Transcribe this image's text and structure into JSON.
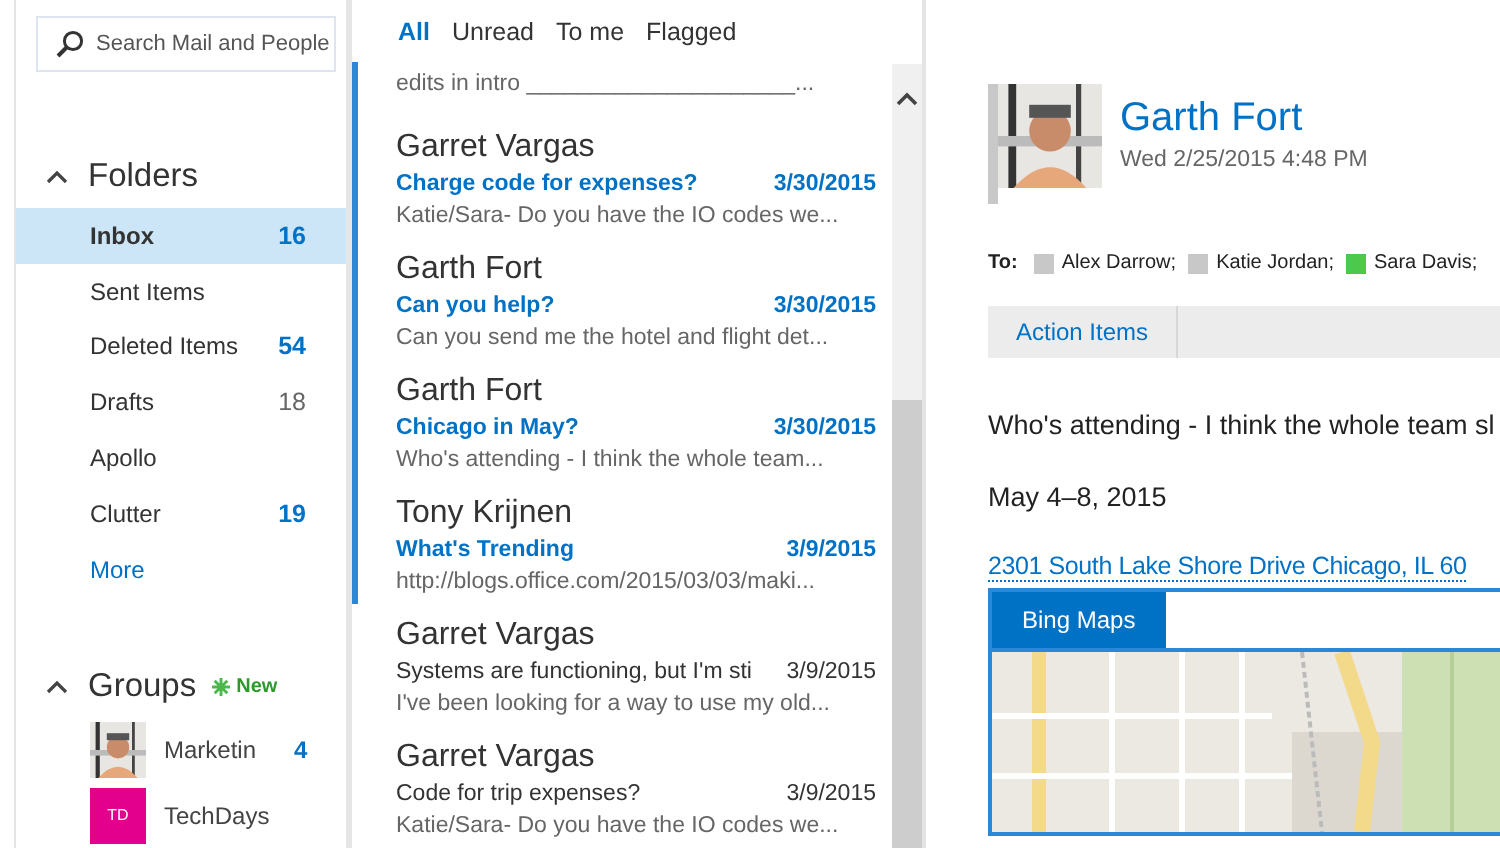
{
  "search": {
    "placeholder": "Search Mail and People"
  },
  "folders": {
    "title": "Folders",
    "expanded": true,
    "items": [
      {
        "label": "Inbox",
        "count": "16",
        "unread": true,
        "selected": true
      },
      {
        "label": "Sent Items",
        "selected": false
      },
      {
        "label": "Deleted Items",
        "count": "54",
        "unread": true,
        "selected": false
      },
      {
        "label": "Drafts",
        "count": "18",
        "unread": false,
        "selected": false
      },
      {
        "label": "Apollo",
        "selected": false
      },
      {
        "label": "Clutter",
        "count": "19",
        "unread": true,
        "selected": false
      }
    ],
    "more": "More"
  },
  "groups": {
    "title": "Groups",
    "expanded": true,
    "badge": "New",
    "items": [
      {
        "name": "Marketin",
        "count": "4",
        "kind": "picture"
      },
      {
        "name": "TechDays",
        "kind": "initials",
        "initials": "TD",
        "color": "#e3008c"
      }
    ]
  },
  "filters": [
    {
      "label": "All",
      "selected": true
    },
    {
      "label": "Unread",
      "selected": false
    },
    {
      "label": "To me",
      "selected": false
    },
    {
      "label": "Flagged",
      "selected": false
    }
  ],
  "messages": [
    {
      "preview": "edits in intro _____________________...",
      "unread": true
    },
    {
      "sender": "Garret Vargas",
      "subject": "Charge code for expenses?",
      "date": "3/30/2015",
      "preview": "Katie/Sara- Do you have the IO codes we...",
      "unread": true
    },
    {
      "sender": "Garth Fort",
      "subject": "Can you help?",
      "date": "3/30/2015",
      "preview": "Can you send me the hotel and flight det...",
      "unread": true
    },
    {
      "sender": "Garth Fort",
      "subject": "Chicago in May?",
      "date": "3/30/2015",
      "preview": "Who's attending - I think the whole team...",
      "unread": true
    },
    {
      "sender": "Tony Krijnen",
      "subject": "What's Trending",
      "date": "3/9/2015",
      "preview": "http://blogs.office.com/2015/03/03/maki...",
      "unread": true
    },
    {
      "sender": "Garret Vargas",
      "subject": "Systems are functioning, but I'm sti",
      "date": "3/9/2015",
      "preview": "I've been looking for a way to use my old...",
      "unread": false
    },
    {
      "sender": "Garret Vargas",
      "subject": "Code for trip expenses?",
      "date": "3/9/2015",
      "preview": "Katie/Sara- Do you have the IO codes we...",
      "unread": false
    }
  ],
  "reading": {
    "sender": "Garth Fort",
    "sent": "Wed 2/25/2015 4:48 PM",
    "to_label": "To:",
    "recipients": [
      {
        "name": "Alex Darrow;",
        "color": "#c8c8c8"
      },
      {
        "name": "Katie Jordan;",
        "color": "#c8c8c8"
      },
      {
        "name": "Sara Davis;",
        "color": "#4cc94c"
      }
    ],
    "apps": [
      "Action Items"
    ],
    "body": [
      "Who's attending - I think the whole team sl",
      "May 4–8, 2015"
    ],
    "link": "2301 South Lake Shore Drive Chicago, IL 60",
    "map": {
      "title": "Bing Maps",
      "kind": "picture"
    }
  }
}
